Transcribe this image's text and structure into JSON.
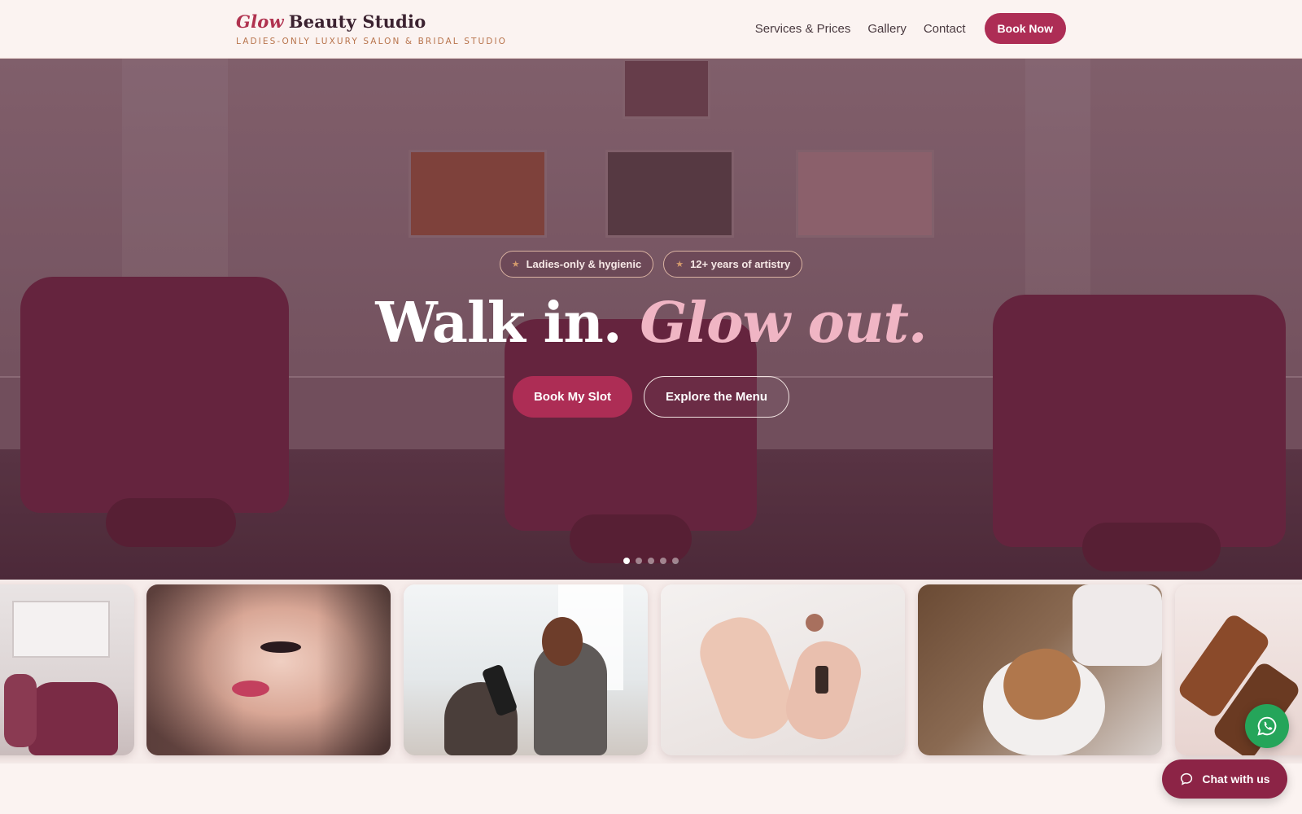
{
  "brand": {
    "name_accent": "Glow",
    "name_rest": "Beauty Studio",
    "tagline": "LADIES-ONLY LUXURY SALON & BRIDAL STUDIO"
  },
  "nav": {
    "items": [
      {
        "label": "Services & Prices"
      },
      {
        "label": "Gallery"
      },
      {
        "label": "Contact"
      }
    ],
    "book_now": "Book Now"
  },
  "hero": {
    "badges": [
      {
        "label": "Ladies-only & hygienic",
        "icon": "star-icon"
      },
      {
        "label": "12+ years of artistry",
        "icon": "star-icon"
      }
    ],
    "headline_plain": "Walk in.",
    "headline_accent": "Glow out.",
    "primary_cta": "Book My Slot",
    "secondary_cta": "Explore the Menu",
    "slides_total": 5,
    "active_slide": 1
  },
  "gallery": {
    "tiles": [
      "salon-interior",
      "makeup-lipstick",
      "hair-blowdry",
      "nail-polish",
      "facial-mask",
      "beauty-products"
    ]
  },
  "floating": {
    "whatsapp_icon": "whatsapp-icon",
    "chat_label": "Chat with us",
    "chat_icon": "chat-bubble-icon"
  },
  "colors": {
    "primary": "#ad2d55",
    "accent_pink": "#f0b5c4",
    "tagline_copper": "#b8744c",
    "background": "#fbf3f1",
    "whatsapp_green": "#25a55a"
  }
}
